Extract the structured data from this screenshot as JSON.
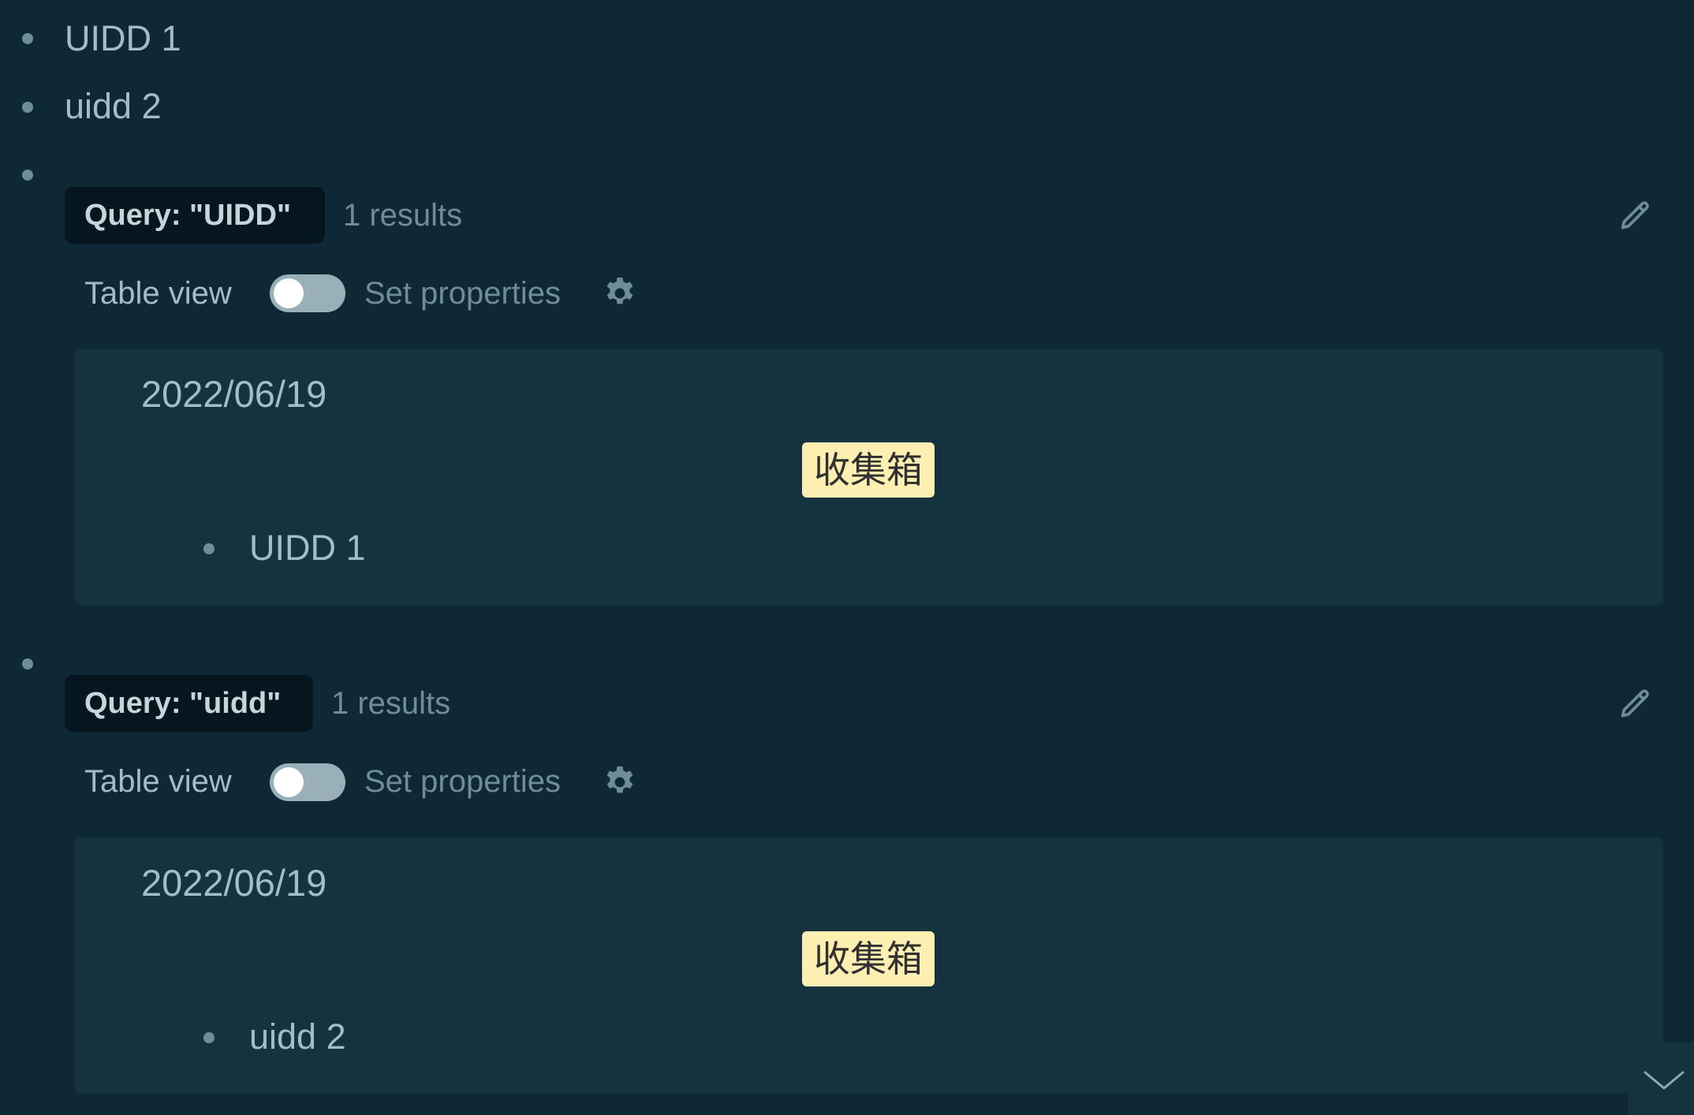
{
  "blocks": [
    {
      "text": "UIDD 1"
    },
    {
      "text": "uidd 2"
    }
  ],
  "queries": [
    {
      "query_label": "Query: \"UIDD\"",
      "results_count": "1 results",
      "table_view_label": "Table view",
      "table_view_on": false,
      "set_properties_label": "Set properties",
      "result": {
        "date": "2022/06/19",
        "tag": "收集箱",
        "item": "UIDD 1"
      }
    },
    {
      "query_label": "Query: \"uidd\"",
      "results_count": "1 results",
      "table_view_label": "Table view",
      "table_view_on": false,
      "set_properties_label": "Set properties",
      "result": {
        "date": "2022/06/19",
        "tag": "收集箱",
        "item": "uidd 2"
      }
    }
  ],
  "icons": {
    "edit": "pencil-icon",
    "settings": "gear-icon",
    "scroll": "chevron-down-icon"
  },
  "colors": {
    "background": "#0f2836",
    "panel": "#14333f",
    "tag": "#fdefb2",
    "query_badge": "#06161e"
  }
}
